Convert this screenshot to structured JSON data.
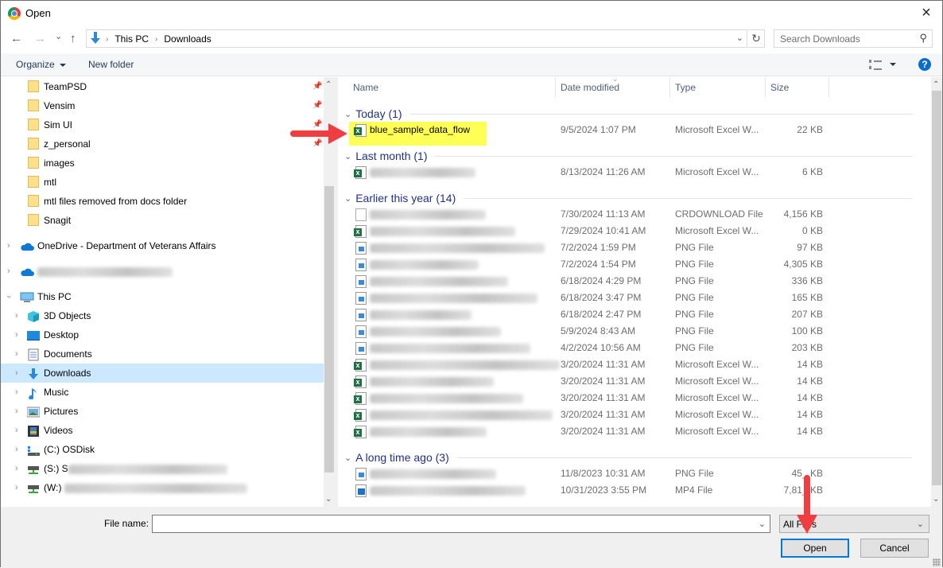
{
  "window": {
    "title": "Open",
    "close_label": "×"
  },
  "navigation": {
    "back": "←",
    "forward": "→",
    "recent": "⌄",
    "up": "↑",
    "breadcrumb": [
      "This PC",
      "Downloads"
    ],
    "refresh": "↻",
    "search_placeholder": "Search Downloads"
  },
  "toolbar": {
    "organize": "Organize",
    "new_folder": "New folder",
    "help": "?"
  },
  "sidebar": {
    "quick_access": [
      {
        "label": "TeamPSD",
        "pinned": true
      },
      {
        "label": "Vensim",
        "pinned": true
      },
      {
        "label": "Sim UI",
        "pinned": true
      },
      {
        "label": "z_personal",
        "pinned": true
      },
      {
        "label": "images",
        "pinned": false
      },
      {
        "label": "mtl",
        "pinned": false
      },
      {
        "label": "mtl files removed from docs folder",
        "pinned": false
      },
      {
        "label": "Snagit",
        "pinned": false
      }
    ],
    "onedrive": "OneDrive - Department of Veterans Affairs",
    "onedrive2": "",
    "this_pc": "This PC",
    "pc_items": [
      {
        "label": "3D Objects",
        "icon": "3d-objects-icon"
      },
      {
        "label": "Desktop",
        "icon": "desktop-icon"
      },
      {
        "label": "Documents",
        "icon": "documents-icon"
      },
      {
        "label": "Downloads",
        "icon": "downloads-icon",
        "selected": true
      },
      {
        "label": "Music",
        "icon": "music-icon"
      },
      {
        "label": "Pictures",
        "icon": "pictures-icon"
      },
      {
        "label": "Videos",
        "icon": "videos-icon"
      },
      {
        "label": "(C:) OSDisk",
        "icon": "drive-icon"
      },
      {
        "label": "(S:) S",
        "icon": "network-drive-icon"
      },
      {
        "label": "(W:)",
        "icon": "network-drive-icon"
      }
    ]
  },
  "columns": {
    "name": "Name",
    "date": "Date modified",
    "type": "Type",
    "size": "Size"
  },
  "groups": [
    {
      "label": "Today (1)",
      "files": [
        {
          "name": "blue_sample_data_flow",
          "date": "9/5/2024 1:07 PM",
          "type": "Microsoft Excel W...",
          "size": "22 KB",
          "icon": "xls",
          "highlighted": true
        }
      ]
    },
    {
      "label": "Last month (1)",
      "files": [
        {
          "name": "",
          "date": "8/13/2024 11:26 AM",
          "type": "Microsoft Excel W...",
          "size": "6 KB",
          "icon": "xls"
        }
      ]
    },
    {
      "label": "Earlier this year (14)",
      "files": [
        {
          "name": "",
          "date": "7/30/2024 11:13 AM",
          "type": "CRDOWNLOAD File",
          "size": "4,156 KB",
          "icon": "gen"
        },
        {
          "name": "",
          "date": "7/29/2024 10:41 AM",
          "type": "Microsoft Excel W...",
          "size": "0 KB",
          "icon": "xls"
        },
        {
          "name": "",
          "date": "7/2/2024 1:59 PM",
          "type": "PNG File",
          "size": "97 KB",
          "icon": "png"
        },
        {
          "name": "",
          "date": "7/2/2024 1:54 PM",
          "type": "PNG File",
          "size": "4,305 KB",
          "icon": "png"
        },
        {
          "name": "",
          "date": "6/18/2024 4:29 PM",
          "type": "PNG File",
          "size": "336 KB",
          "icon": "png"
        },
        {
          "name": "",
          "date": "6/18/2024 3:47 PM",
          "type": "PNG File",
          "size": "165 KB",
          "icon": "png"
        },
        {
          "name": "",
          "date": "6/18/2024 2:47 PM",
          "type": "PNG File",
          "size": "207 KB",
          "icon": "png"
        },
        {
          "name": "",
          "date": "5/9/2024 8:43 AM",
          "type": "PNG File",
          "size": "100 KB",
          "icon": "png"
        },
        {
          "name": "",
          "date": "4/2/2024 10:56 AM",
          "type": "PNG File",
          "size": "203 KB",
          "icon": "png"
        },
        {
          "name": "",
          "date": "3/20/2024 11:31 AM",
          "type": "Microsoft Excel W...",
          "size": "14 KB",
          "icon": "xls"
        },
        {
          "name": "",
          "date": "3/20/2024 11:31 AM",
          "type": "Microsoft Excel W...",
          "size": "14 KB",
          "icon": "xls"
        },
        {
          "name": "",
          "date": "3/20/2024 11:31 AM",
          "type": "Microsoft Excel W...",
          "size": "14 KB",
          "icon": "xls"
        },
        {
          "name": "",
          "date": "3/20/2024 11:31 AM",
          "type": "Microsoft Excel W...",
          "size": "14 KB",
          "icon": "xls"
        },
        {
          "name": "",
          "date": "3/20/2024 11:31 AM",
          "type": "Microsoft Excel W...",
          "size": "14 KB",
          "icon": "xls"
        }
      ]
    },
    {
      "label": "A long time ago (3)",
      "files": [
        {
          "name": "",
          "date": "11/8/2023 10:31 AM",
          "type": "PNG File",
          "size": "45_ KB",
          "icon": "png"
        },
        {
          "name": "",
          "date": "10/31/2023 3:55 PM",
          "type": "MP4 File",
          "size": "7,81_ KB",
          "icon": "mp4"
        }
      ]
    }
  ],
  "footer": {
    "file_name_label": "File name:",
    "file_name_value": "",
    "file_type": "All Files",
    "open": "Open",
    "cancel": "Cancel"
  },
  "colors": {
    "highlight": "#ffff55",
    "annotation_arrow": "#ef3d42",
    "selection": "#cce8ff",
    "primary_border": "#0078d7"
  }
}
